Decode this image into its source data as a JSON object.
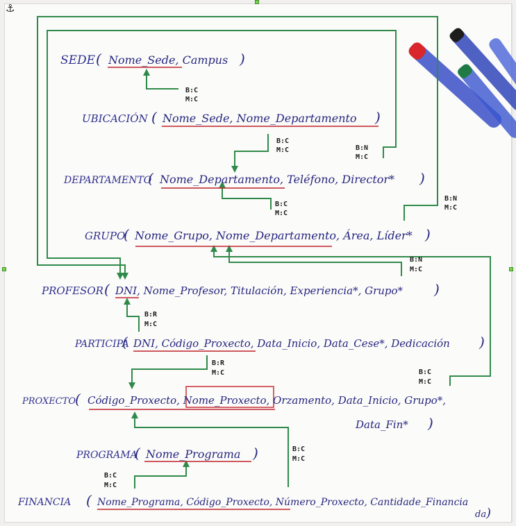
{
  "colors": {
    "ink": "#262680",
    "underline": "#c0222a",
    "connector": "#2f8a4a",
    "handle": "#7bd44e"
  },
  "icons": {
    "anchor": "anchor-icon",
    "handle": "selection-handle-icon"
  },
  "relations": {
    "sede": {
      "name": "SEDE",
      "open": "(",
      "attrs": "Nome_Sede, Campus",
      "close": ")"
    },
    "ubicacion": {
      "name": "UBICACIÓN",
      "open": "(",
      "attrs": "Nome_Sede, Nome_Departamento",
      "close": ")"
    },
    "departamento": {
      "name": "DEPARTAMENTO",
      "open": "(",
      "attrs": "Nome_Departamento, Teléfono, Director*",
      "close": ")"
    },
    "grupo": {
      "name": "GRUPO",
      "open": "(",
      "attrs": "Nome_Grupo, Nome_Departamento, Área, Líder*",
      "close": ")"
    },
    "profesor": {
      "name": "PROFESOR",
      "open": "(",
      "attrs": "DNI, Nome_Profesor, Titulación, Experiencia*, Grupo*",
      "close": ")"
    },
    "participa": {
      "name": "PARTICIPA",
      "open": "(",
      "attrs": "DNI, Código_Proxecto, Data_Inicio, Data_Cese*, Dedicación",
      "close": ")"
    },
    "proxecto": {
      "name": "PROXECTO",
      "open": "(",
      "attrs": "Código_Proxecto, Nome_Proxecto, Orzamento, Data_Inicio, Grupo*,",
      "attrs2": "Data_Fin*",
      "close": ")"
    },
    "programa": {
      "name": "PROGRAMA",
      "open": "(",
      "attrs": "Nome_Programa",
      "close": ")"
    },
    "financia": {
      "name": "FINANCIA",
      "open": "(",
      "attrs": "Nome_Programa, Código_Proxecto, Número_Proxecto, Cantidade_Financia",
      "attrs2": "da",
      "close": ")"
    }
  },
  "cardinalities": {
    "c1": {
      "b": "B:C",
      "m": "M:C"
    },
    "c2": {
      "b": "B:C",
      "m": "M:C"
    },
    "c3": {
      "b": "B:N",
      "m": "M:C"
    },
    "c4": {
      "b": "B:C",
      "m": "M:C"
    },
    "c5": {
      "b": "B:N",
      "m": "M:C"
    },
    "c6": {
      "b": "B:N",
      "m": "M:C"
    },
    "c7": {
      "b": "B:R",
      "m": "M:C"
    },
    "c8": {
      "b": "B:R",
      "m": "M:C"
    },
    "c9": {
      "b": "B:C",
      "m": "M:C"
    },
    "c10": {
      "b": "B:C",
      "m": "M:C"
    },
    "c11": {
      "b": "B:C",
      "m": "M:C"
    }
  }
}
